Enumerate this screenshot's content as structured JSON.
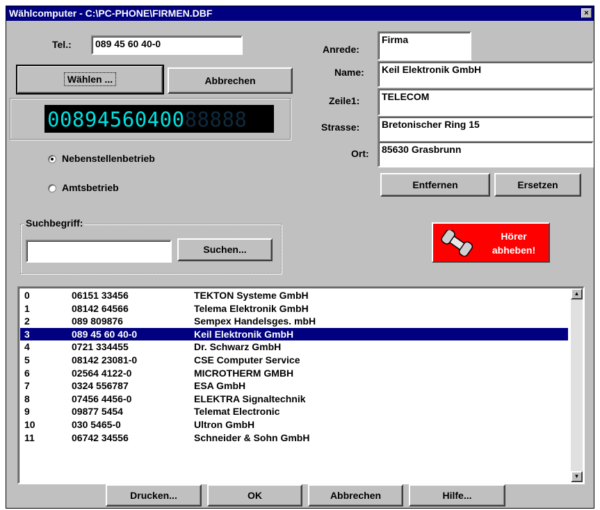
{
  "window": {
    "title": "Wählcomputer - C:\\PC-PHONE\\FIRMEN.DBF",
    "close": "×"
  },
  "tel": {
    "label": "Tel.:",
    "value": "089 45 60 40-0"
  },
  "buttons": {
    "waehlen": "Wählen ...",
    "abbrechen_top": "Abbrechen",
    "entfernen": "Entfernen",
    "ersetzen": "Ersetzen",
    "suchen": "Suchen...",
    "drucken": "Drucken...",
    "ok": "OK",
    "abbrechen": "Abbrechen",
    "hilfe": "Hilfe..."
  },
  "display": {
    "lit": "00894560400",
    "unlit": "88888"
  },
  "mode": {
    "option1": "Nebenstellenbetrieb",
    "option2": "Amtsbetrieb",
    "selected": "Nebenstellenbetrieb"
  },
  "search": {
    "label": "Suchbegriff:",
    "value": ""
  },
  "contact": {
    "anrede_label": "Anrede:",
    "anrede": "Firma",
    "name_label": "Name:",
    "name": "Keil Elektronik GmbH",
    "zeile1_label": "Zeile1:",
    "zeile1": "TELECOM",
    "strasse_label": "Strasse:",
    "strasse": "Bretonischer Ring 15",
    "ort_label": "Ort:",
    "ort": "85630 Grasbrunn"
  },
  "hoerer": {
    "line1": "Hörer",
    "line2": "abheben!",
    "icon": "telephone-handset-icon"
  },
  "list": {
    "selected_index": 3,
    "rows": [
      {
        "nr": "0",
        "tel": "06151 33456",
        "firma": "TEKTON Systeme GmbH"
      },
      {
        "nr": "1",
        "tel": "08142 64566",
        "firma": "Telema Elektronik GmbH"
      },
      {
        "nr": "2",
        "tel": "089 809876",
        "firma": "Sempex Handelsges. mbH"
      },
      {
        "nr": "3",
        "tel": "089 45 60 40-0",
        "firma": "Keil Elektronik GmbH"
      },
      {
        "nr": "4",
        "tel": "0721 334455",
        "firma": "Dr. Schwarz GmbH"
      },
      {
        "nr": "5",
        "tel": "08142 23081-0",
        "firma": "CSE Computer Service"
      },
      {
        "nr": "6",
        "tel": "02564 4122-0",
        "firma": "MICROTHERM GMBH"
      },
      {
        "nr": "7",
        "tel": "0324 556787",
        "firma": "ESA GmbH"
      },
      {
        "nr": "8",
        "tel": "07456 4456-0",
        "firma": "ELEKTRA Signaltechnik"
      },
      {
        "nr": "9",
        "tel": "09877 5454",
        "firma": "Telemat Electronic"
      },
      {
        "nr": "10",
        "tel": "030 5465-0",
        "firma": "Ultron GmbH"
      },
      {
        "nr": "11",
        "tel": "06742 34556",
        "firma": "Schneider & Sohn GmbH"
      }
    ]
  },
  "colors": {
    "titlebar": "#000080",
    "selection": "#000080",
    "lcd_on": "#00e0e0",
    "hoerer_bg": "#ff0000",
    "dialog": "#c0c0c0"
  }
}
